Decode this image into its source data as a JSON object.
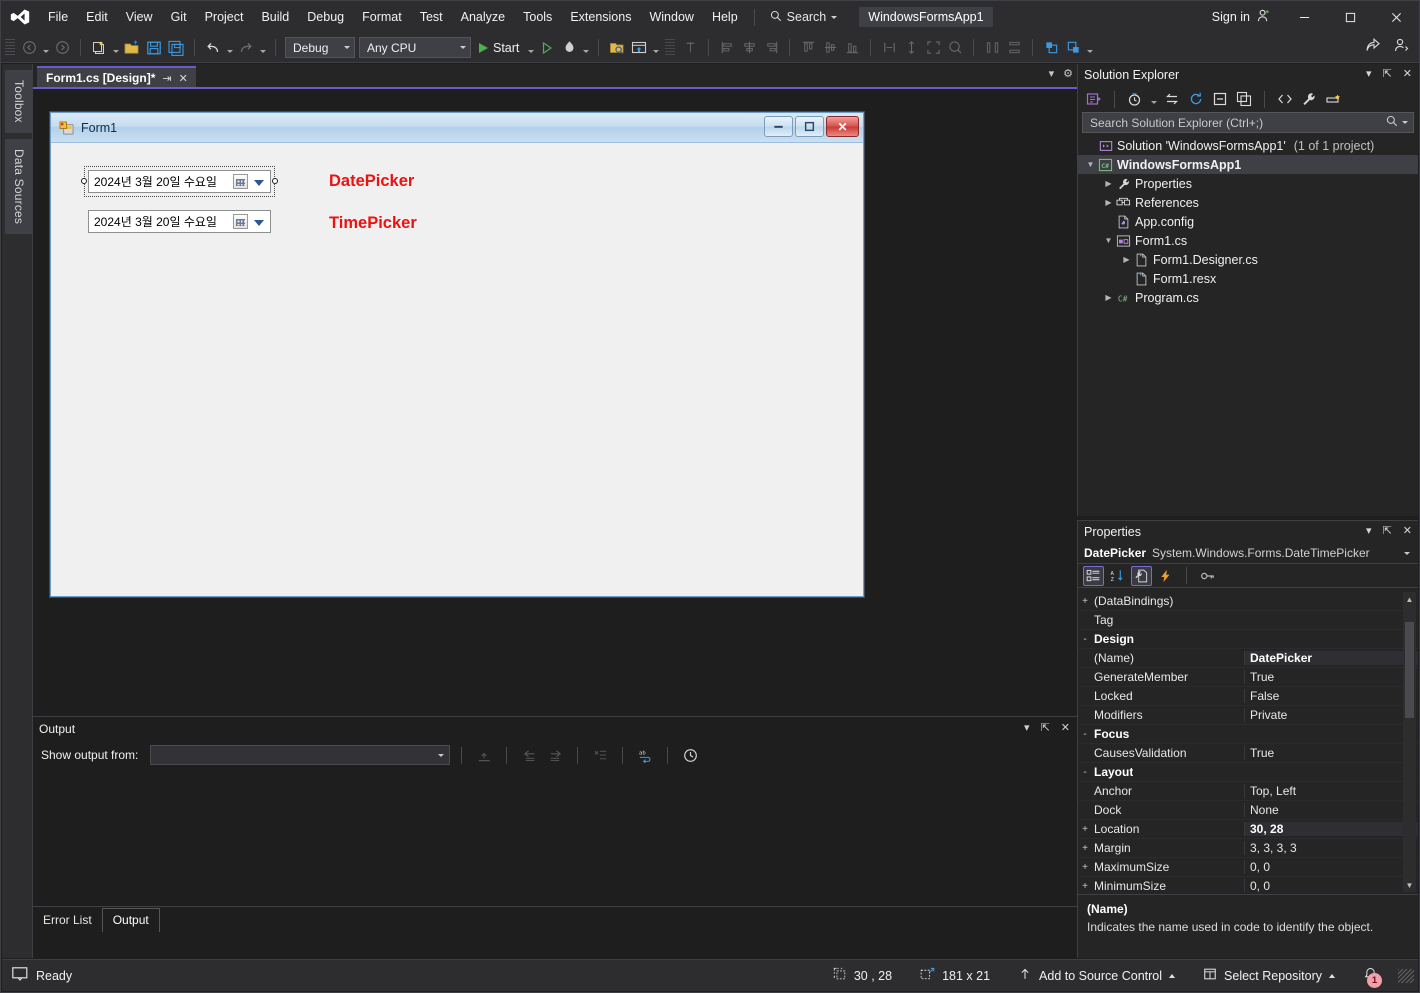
{
  "app": {
    "product": "Visual Studio",
    "project_chip": "WindowsFormsApp1",
    "sign_in": "Sign in",
    "search_placeholder": "Search"
  },
  "menu": {
    "items": [
      {
        "label": "File"
      },
      {
        "label": "Edit"
      },
      {
        "label": "View"
      },
      {
        "label": "Git"
      },
      {
        "label": "Project"
      },
      {
        "label": "Build"
      },
      {
        "label": "Debug"
      },
      {
        "label": "Format"
      },
      {
        "label": "Test"
      },
      {
        "label": "Analyze"
      },
      {
        "label": "Tools"
      },
      {
        "label": "Extensions"
      },
      {
        "label": "Window"
      },
      {
        "label": "Help"
      }
    ]
  },
  "toolbar": {
    "configuration": "Debug",
    "platform": "Any CPU",
    "start_label": "Start"
  },
  "left_rail": {
    "tabs": [
      {
        "label": "Toolbox"
      },
      {
        "label": "Data Sources"
      }
    ]
  },
  "document_tab": {
    "title": "Form1.cs [Design]*"
  },
  "designer": {
    "form_title": "Form1",
    "date_picker": {
      "value": "2024년  3월 20일 수요일",
      "label": "DatePicker"
    },
    "time_picker": {
      "value": "2024년  3월 20일 수요일",
      "label": "TimePicker"
    }
  },
  "output_panel": {
    "title": "Output",
    "show_output_from_label": "Show output from:",
    "show_output_from_value": "",
    "tabs": [
      {
        "label": "Error List",
        "active": false
      },
      {
        "label": "Output",
        "active": true
      }
    ]
  },
  "solution_explorer": {
    "title": "Solution Explorer",
    "search_placeholder": "Search Solution Explorer (Ctrl+;)",
    "tree": [
      {
        "label": "Solution 'WindowsFormsApp1'",
        "suffix": "(1 of 1 project)",
        "indent": 0,
        "arrow": "",
        "icon": "solution-icon",
        "selected": false,
        "bold": false
      },
      {
        "label": "WindowsFormsApp1",
        "suffix": "",
        "indent": 1,
        "arrow": "down",
        "icon": "csharp-project-icon",
        "selected": true,
        "bold": true
      },
      {
        "label": "Properties",
        "suffix": "",
        "indent": 2,
        "arrow": "right",
        "icon": "wrench-icon",
        "selected": false,
        "bold": false
      },
      {
        "label": "References",
        "suffix": "",
        "indent": 2,
        "arrow": "right",
        "icon": "references-icon",
        "selected": false,
        "bold": false
      },
      {
        "label": "App.config",
        "suffix": "",
        "indent": 2,
        "arrow": "",
        "icon": "config-file-icon",
        "selected": false,
        "bold": false
      },
      {
        "label": "Form1.cs",
        "suffix": "",
        "indent": 2,
        "arrow": "down",
        "icon": "form-icon",
        "selected": false,
        "bold": false
      },
      {
        "label": "Form1.Designer.cs",
        "suffix": "",
        "indent": 3,
        "arrow": "right",
        "icon": "file-icon",
        "selected": false,
        "bold": false
      },
      {
        "label": "Form1.resx",
        "suffix": "",
        "indent": 3,
        "arrow": "",
        "icon": "file-icon",
        "selected": false,
        "bold": false
      },
      {
        "label": "Program.cs",
        "suffix": "",
        "indent": 2,
        "arrow": "right",
        "icon": "csharp-file-icon",
        "selected": false,
        "bold": false
      }
    ]
  },
  "properties_panel": {
    "title": "Properties",
    "object_name": "DatePicker",
    "object_type": "System.Windows.Forms.DateTimePicker",
    "rows": [
      {
        "kind": "prop",
        "expander": "+",
        "name": "(DataBindings)",
        "value": "",
        "highlight": false
      },
      {
        "kind": "prop",
        "expander": "",
        "name": "Tag",
        "value": "",
        "highlight": false
      },
      {
        "kind": "cat",
        "expander": "-",
        "name": "Design",
        "value": "",
        "highlight": false
      },
      {
        "kind": "prop",
        "expander": "",
        "name": "(Name)",
        "value": "DatePicker",
        "highlight": true
      },
      {
        "kind": "prop",
        "expander": "",
        "name": "GenerateMember",
        "value": "True",
        "highlight": false
      },
      {
        "kind": "prop",
        "expander": "",
        "name": "Locked",
        "value": "False",
        "highlight": false
      },
      {
        "kind": "prop",
        "expander": "",
        "name": "Modifiers",
        "value": "Private",
        "highlight": false
      },
      {
        "kind": "cat",
        "expander": "-",
        "name": "Focus",
        "value": "",
        "highlight": false
      },
      {
        "kind": "prop",
        "expander": "",
        "name": "CausesValidation",
        "value": "True",
        "highlight": false
      },
      {
        "kind": "cat",
        "expander": "-",
        "name": "Layout",
        "value": "",
        "highlight": false
      },
      {
        "kind": "prop",
        "expander": "",
        "name": "Anchor",
        "value": "Top, Left",
        "highlight": false
      },
      {
        "kind": "prop",
        "expander": "",
        "name": "Dock",
        "value": "None",
        "highlight": false
      },
      {
        "kind": "prop",
        "expander": "+",
        "name": "Location",
        "value": "30, 28",
        "highlight": true
      },
      {
        "kind": "prop",
        "expander": "+",
        "name": "Margin",
        "value": "3, 3, 3, 3",
        "highlight": false
      },
      {
        "kind": "prop",
        "expander": "+",
        "name": "MaximumSize",
        "value": "0, 0",
        "highlight": false
      },
      {
        "kind": "prop",
        "expander": "+",
        "name": "MinimumSize",
        "value": "0, 0",
        "highlight": false
      }
    ],
    "description": {
      "title": "(Name)",
      "text": "Indicates the name used in code to identify the object."
    }
  },
  "status_bar": {
    "ready": "Ready",
    "location": "30 , 28",
    "size": "181 x 21",
    "source_control": "Add to Source Control",
    "repository": "Select Repository",
    "notification_count": "1"
  },
  "colors": {
    "accent_purple": "#6a5acd",
    "chrome": "#2d2d30",
    "panel": "#252526",
    "editor": "#1e1e1e",
    "label_red": "#ee1111",
    "start_green": "#4caf50"
  }
}
